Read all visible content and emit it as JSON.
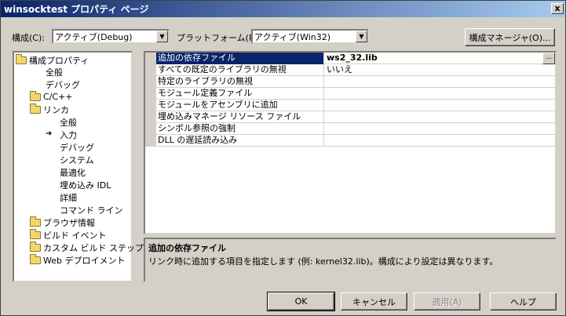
{
  "window": {
    "title": "winsocktest プロパティ ページ",
    "close_glyph": "x"
  },
  "config": {
    "label": "構成(C):",
    "value": "アクティブ(Debug)"
  },
  "platform": {
    "label": "プラットフォーム(P):",
    "value": "アクティブ(Win32)"
  },
  "config_manager_button": "構成マネージャ(O)...",
  "tree": {
    "root": "構成プロパティ",
    "items": [
      "全般",
      "デバッグ",
      "C/C++",
      "リンカ",
      "全般",
      "入力",
      "デバッグ",
      "システム",
      "最適化",
      "埋め込み IDL",
      "詳細",
      "コマンド ライン",
      "ブラウザ情報",
      "ビルド イベント",
      "カスタム ビルド ステップ",
      "Web デプロイメント"
    ]
  },
  "properties": [
    {
      "name": "追加の依存ファイル",
      "value": "ws2_32.lib"
    },
    {
      "name": "すべての既定のライブラリの無視",
      "value": "いいえ"
    },
    {
      "name": "特定のライブラリの無視",
      "value": ""
    },
    {
      "name": "モジュール定義ファイル",
      "value": ""
    },
    {
      "name": "モジュールをアセンブリに追加",
      "value": ""
    },
    {
      "name": "埋め込みマネージ リソース ファイル",
      "value": ""
    },
    {
      "name": "シンボル参照の強制",
      "value": ""
    },
    {
      "name": "DLL の遅延読み込み",
      "value": ""
    }
  ],
  "ellipsis_label": "...",
  "description": {
    "title": "追加の依存ファイル",
    "text": "リンク時に追加する項目を指定します (例: kernel32.lib)。構成により設定は異なります。"
  },
  "buttons": {
    "ok": "OK",
    "cancel": "キャンセル",
    "apply": "適用(A)",
    "help": "ヘルプ"
  },
  "colors": {
    "selection": "#0a246a",
    "face": "#d4d0c8"
  }
}
